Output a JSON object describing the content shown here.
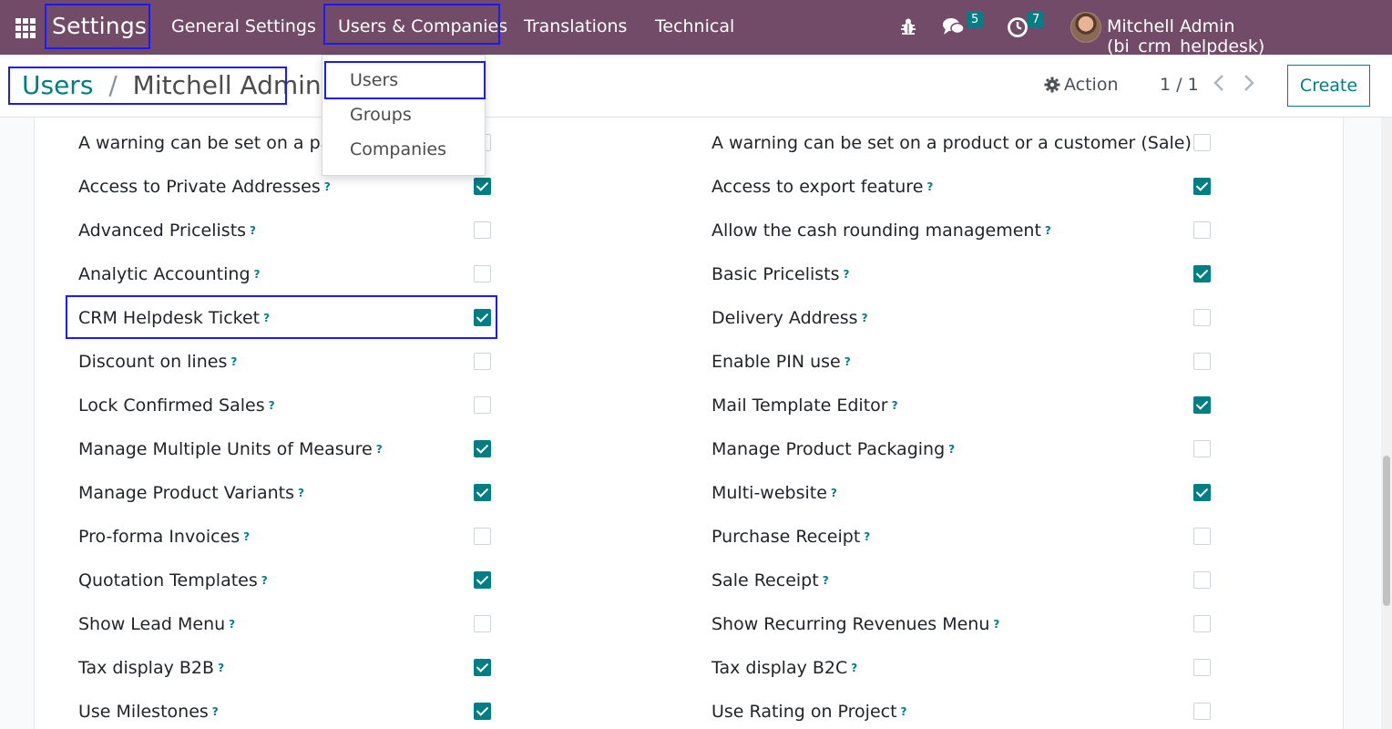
{
  "navbar": {
    "brand": "Settings",
    "menus": [
      "General Settings",
      "Users & Companies",
      "Translations",
      "Technical"
    ],
    "messages_count": "5",
    "activities_count": "7",
    "user_name": "Mitchell Admin (bi_crm_helpdesk)"
  },
  "dropdown": {
    "items": [
      "Users",
      "Groups",
      "Companies"
    ]
  },
  "breadcrumb": {
    "parent": "Users",
    "separator": "/",
    "current": "Mitchell Admin"
  },
  "control": {
    "action_label": "Action",
    "pager": "1 / 1",
    "create_label": "Create"
  },
  "settings": {
    "left": [
      {
        "label": "A warning can be set on a part",
        "checked": false
      },
      {
        "label": "Access to Private Addresses",
        "checked": true
      },
      {
        "label": "Advanced Pricelists",
        "checked": false
      },
      {
        "label": "Analytic Accounting",
        "checked": false
      },
      {
        "label": "CRM Helpdesk Ticket",
        "checked": true
      },
      {
        "label": "Discount on lines",
        "checked": false
      },
      {
        "label": "Lock Confirmed Sales",
        "checked": false
      },
      {
        "label": "Manage Multiple Units of Measure",
        "checked": true
      },
      {
        "label": "Manage Product Variants",
        "checked": true
      },
      {
        "label": "Pro-forma Invoices",
        "checked": false
      },
      {
        "label": "Quotation Templates",
        "checked": true
      },
      {
        "label": "Show Lead Menu",
        "checked": false
      },
      {
        "label": "Tax display B2B",
        "checked": true
      },
      {
        "label": "Use Milestones",
        "checked": true
      }
    ],
    "right": [
      {
        "label": "A warning can be set on a product or a customer (Sale)",
        "checked": false
      },
      {
        "label": "Access to export feature",
        "checked": true
      },
      {
        "label": "Allow the cash rounding management",
        "checked": false
      },
      {
        "label": "Basic Pricelists",
        "checked": true
      },
      {
        "label": "Delivery Address",
        "checked": false
      },
      {
        "label": "Enable PIN use",
        "checked": false
      },
      {
        "label": "Mail Template Editor",
        "checked": true
      },
      {
        "label": "Manage Product Packaging",
        "checked": false
      },
      {
        "label": "Multi-website",
        "checked": true
      },
      {
        "label": "Purchase Receipt",
        "checked": false
      },
      {
        "label": "Sale Receipt",
        "checked": false
      },
      {
        "label": "Show Recurring Revenues Menu",
        "checked": false
      },
      {
        "label": "Tax display B2C",
        "checked": false
      },
      {
        "label": "Use Rating on Project",
        "checked": false
      }
    ],
    "help_mark": "?"
  },
  "colors": {
    "navbar": "#714b67",
    "accent": "#017e84",
    "highlight": "#1a1aff"
  }
}
